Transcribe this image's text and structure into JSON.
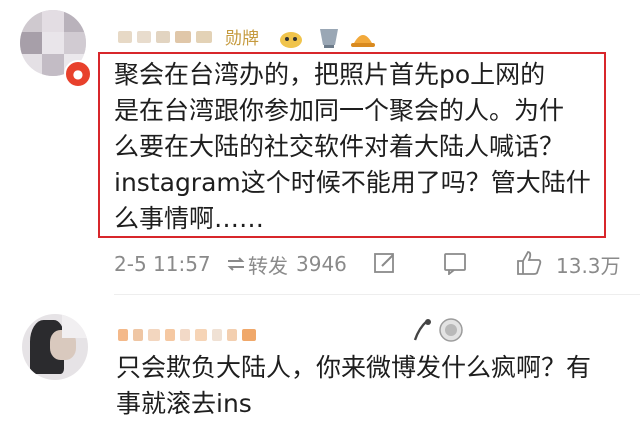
{
  "comments": [
    {
      "content": "聚会在台湾办的，把照片首先po上网的\n是在台湾跟你参加同一个聚会的人。为什\n么要在大陆的社交软件对着大陆人喊话？\ninstagram这个时候不能用了吗？管大陆什\n么事情啊……",
      "time": "2-5 11:57",
      "repost_label": "转发",
      "repost_count": "3946",
      "like_count": "13.3万",
      "icons": {
        "badge": "red-v-badge-icon",
        "edit": "edit-icon",
        "comment": "comment-icon",
        "like": "thumbs-up-icon",
        "fan_badge_1": "medal-icon",
        "fan_badge_2": "cat-icon",
        "fan_badge_3": "cup-icon",
        "fan_badge_4": "hat-icon"
      }
    },
    {
      "content": "只会欺负大陆人，你来微博发什么疯啊？有\n事就滚去ins",
      "icons": {
        "fan_badge_1": "mic-icon",
        "fan_badge_2": "medal-icon"
      }
    }
  ],
  "colors": {
    "highlight": "#d8262b",
    "text": "#1e1e1e",
    "meta": "#8a8a8a"
  }
}
